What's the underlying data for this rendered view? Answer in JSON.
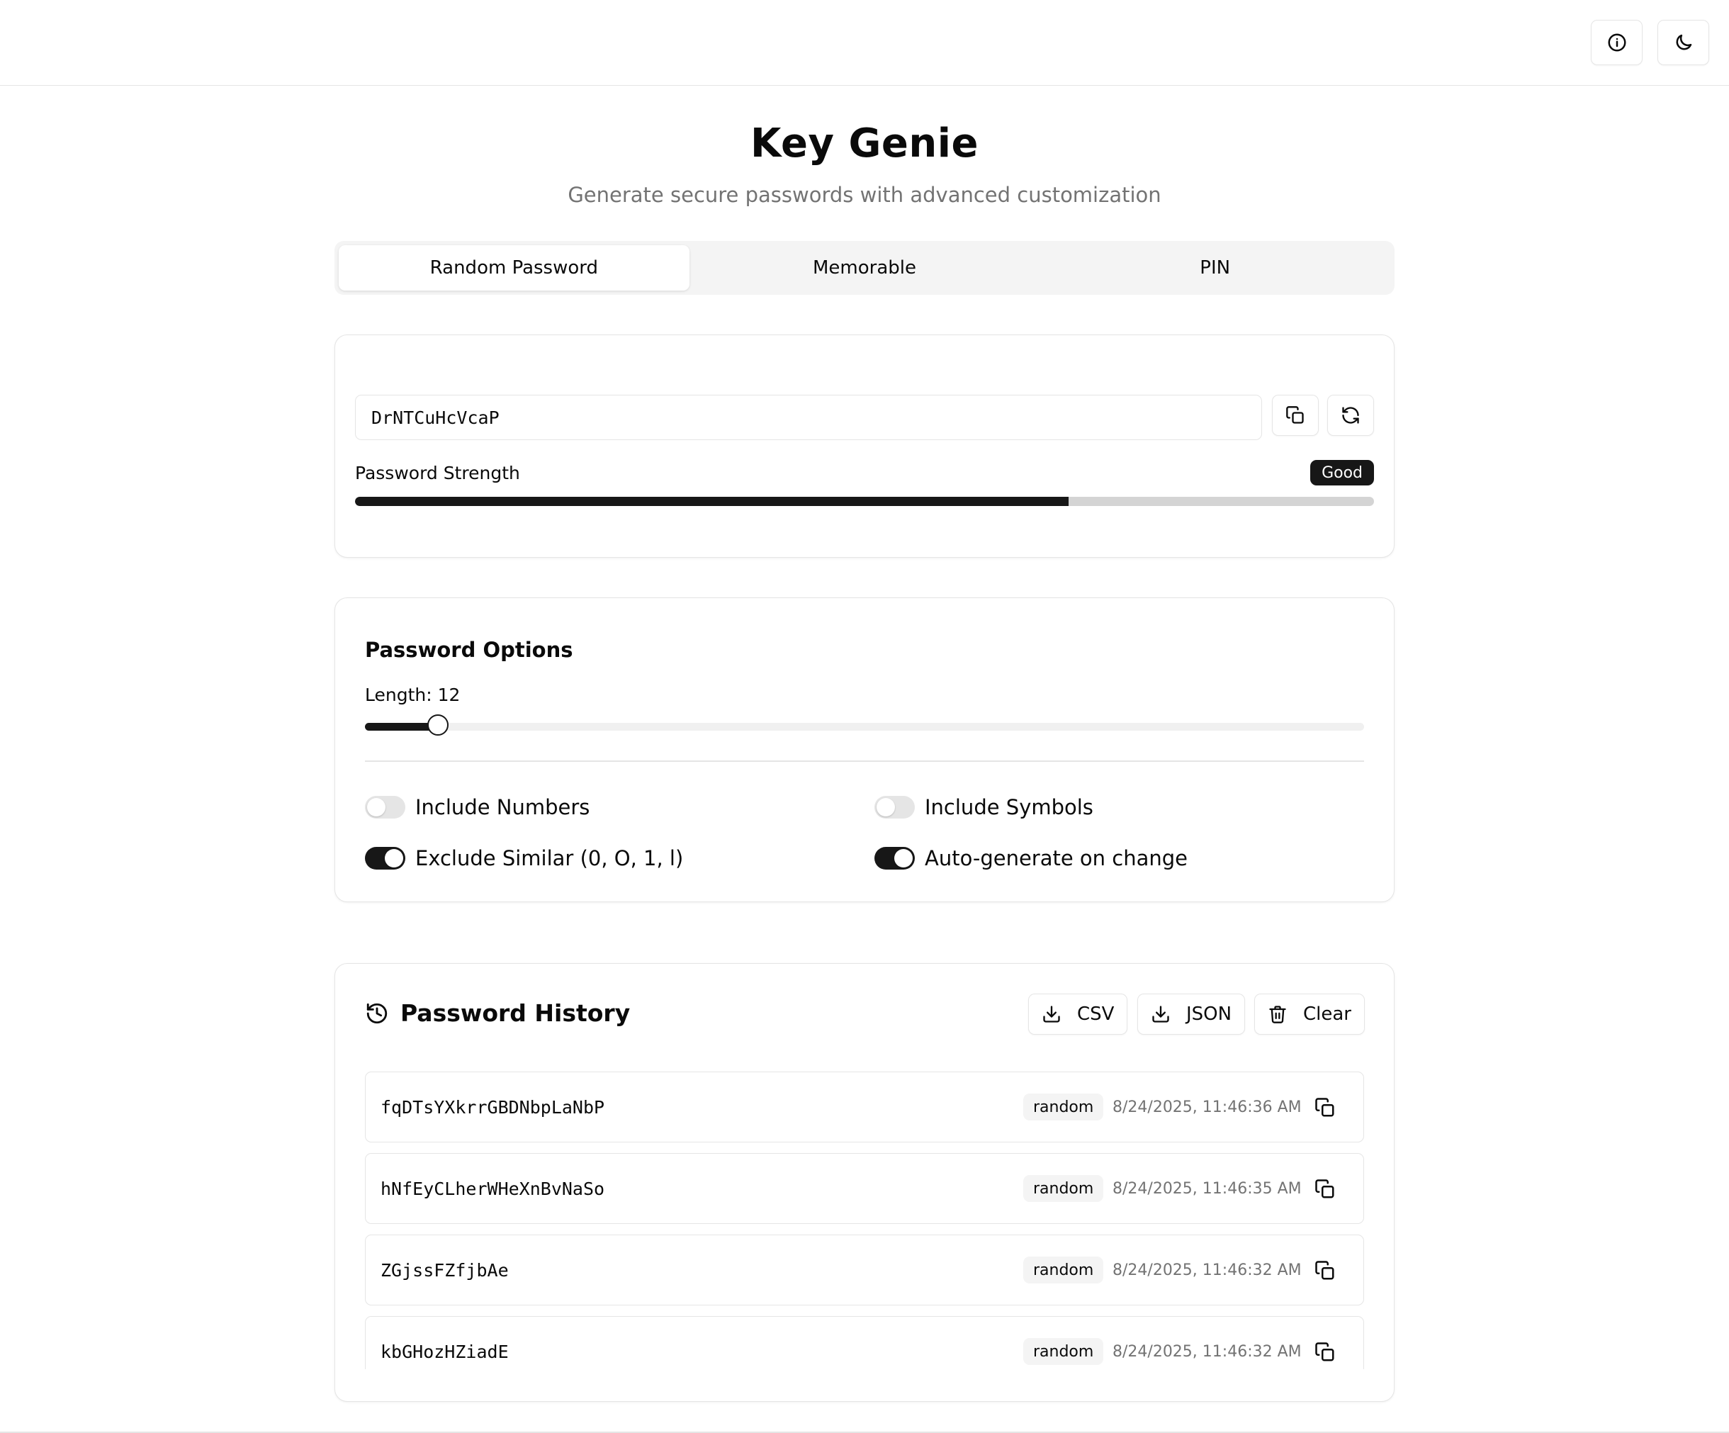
{
  "app": {
    "title": "Key Genie",
    "subtitle": "Generate secure passwords with advanced customization"
  },
  "header": {
    "buttons": [
      {
        "icon": "info-icon"
      },
      {
        "icon": "moon-icon"
      }
    ]
  },
  "tabs": [
    {
      "label": "Random Password",
      "active": true
    },
    {
      "label": "Memorable",
      "active": false
    },
    {
      "label": "PIN",
      "active": false
    }
  ],
  "generator": {
    "password": "DrNTCuHcVcaP",
    "strength_label": "Password Strength",
    "strength_badge": "Good",
    "strength_fraction": 0.7
  },
  "options": {
    "title": "Password Options",
    "length_label": "Length: 12",
    "length_slider_fraction": 0.073,
    "toggles": [
      {
        "label": "Include Numbers",
        "on": false
      },
      {
        "label": "Include Symbols",
        "on": false
      },
      {
        "label": "Exclude Similar (0, O, 1, l)",
        "on": true
      },
      {
        "label": "Auto-generate on change",
        "on": true
      }
    ]
  },
  "history": {
    "title": "Password History",
    "buttons": {
      "csv": "CSV",
      "json": "JSON",
      "clear": "Clear"
    },
    "items": [
      {
        "password": "fqDTsYXkrrGBDNbpLaNbP",
        "type": "random",
        "time": "8/24/2025, 11:46:36 AM"
      },
      {
        "password": "hNfEyCLherWHeXnBvNaSo",
        "type": "random",
        "time": "8/24/2025, 11:46:35 AM"
      },
      {
        "password": "ZGjssFZfjbAe",
        "type": "random",
        "time": "8/24/2025, 11:46:32 AM"
      },
      {
        "password": "kbGHozHZiadE",
        "type": "random",
        "time": "8/24/2025, 11:46:32 AM"
      }
    ]
  },
  "colors": {
    "accent": "#171717",
    "muted_text": "#737373",
    "border": "#e5e5e5",
    "tab_bg": "#f4f4f4"
  }
}
